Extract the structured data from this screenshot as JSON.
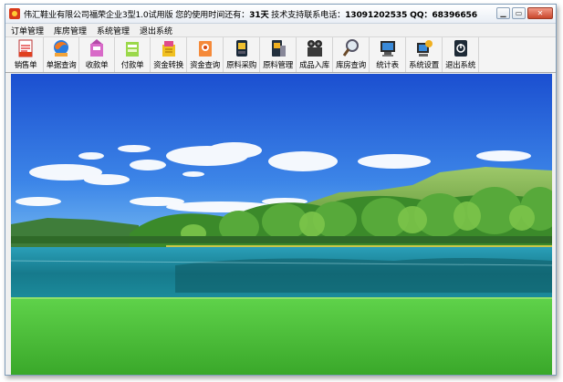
{
  "window": {
    "title_prefix": "伟汇鞋业有限公司福荣企业3型1.0试用版  您的使用时间还有：",
    "remaining_days": "31天",
    "support_label": "  技术支持联系电话：",
    "phone": "13091202535",
    "qq_label": " QQ：",
    "qq": "68396656"
  },
  "menu": {
    "items": [
      "订单管理",
      "库房管理",
      "系统管理",
      "退出系统"
    ]
  },
  "toolbar": {
    "buttons": [
      {
        "label": "销售单",
        "icon": "sales-form-icon"
      },
      {
        "label": "单据查询",
        "icon": "document-query-icon"
      },
      {
        "label": "收款单",
        "icon": "receipt-icon"
      },
      {
        "label": "付款单",
        "icon": "payment-icon"
      },
      {
        "label": "资金转换",
        "icon": "fund-transfer-icon"
      },
      {
        "label": "资金查询",
        "icon": "fund-query-icon"
      },
      {
        "label": "原料采购",
        "icon": "material-purchase-icon"
      },
      {
        "label": "原料管理",
        "icon": "material-manage-icon"
      },
      {
        "label": "成品入库",
        "icon": "product-warehouse-icon"
      },
      {
        "label": "库房查询",
        "icon": "warehouse-query-icon"
      },
      {
        "label": "统计表",
        "icon": "statistics-icon"
      },
      {
        "label": "系统设置",
        "icon": "system-settings-icon"
      },
      {
        "label": "退出系统",
        "icon": "exit-system-icon"
      }
    ]
  },
  "colors": {
    "sky_top": "#1c55d6",
    "sky_bottom": "#5aa8f0",
    "grass": "#4ec43a",
    "water": "#1a8fa8",
    "close_button": "#c9462c"
  }
}
